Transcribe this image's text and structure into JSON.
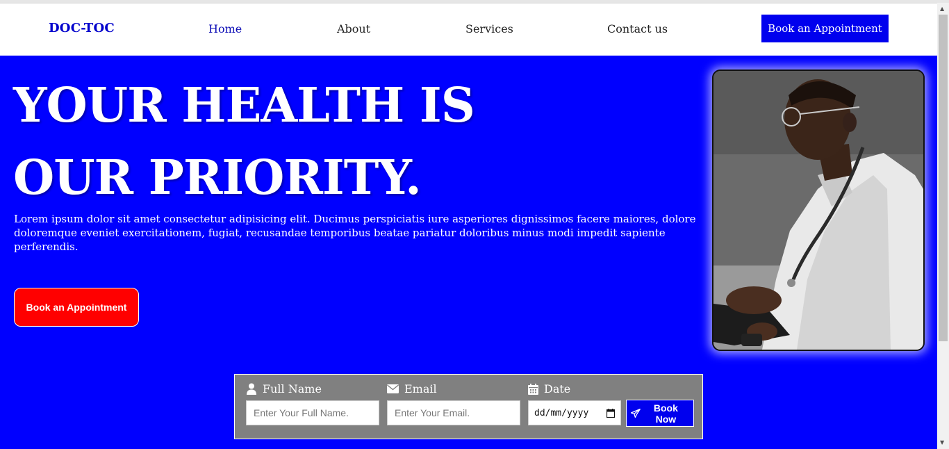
{
  "nav": {
    "logo": "DOC-TOC",
    "links": [
      {
        "label": "Home",
        "active": true
      },
      {
        "label": "About"
      },
      {
        "label": "Services"
      },
      {
        "label": "Contact us"
      }
    ],
    "cta_label": "Book an Appointment"
  },
  "hero": {
    "title_line1": "YOUR HEALTH IS",
    "title_line2": "OUR PRIORITY.",
    "text": "Lorem ipsum dolor sit amet consectetur adipisicing elit. Ducimus perspiciatis iure asperiores dignissimos facere maiores, dolore doloremque eveniet exercitationem, fugiat, recusandae temporibus beatae pariatur doloribus minus modi impedit sapiente perferendis.",
    "cta_label": "Book an Appointment"
  },
  "booking": {
    "name_label": "Full Name",
    "name_placeholder": "Enter Your Full Name.",
    "email_label": "Email",
    "email_placeholder": "Enter Your Email.",
    "date_label": "Date",
    "date_placeholder": "dd/mm/yyyy",
    "submit_label": "Book Now"
  },
  "icons": {
    "name": "user-icon",
    "email": "envelope-icon",
    "date": "calendar-icon",
    "submit": "paper-plane-icon",
    "date_picker": "calendar-picker-icon"
  },
  "colors": {
    "hero_bg": "#0000ff",
    "logo": "#0000cc",
    "primary_button": "#0000ee",
    "hero_button": "#ff0000",
    "form_bg": "#808080"
  }
}
